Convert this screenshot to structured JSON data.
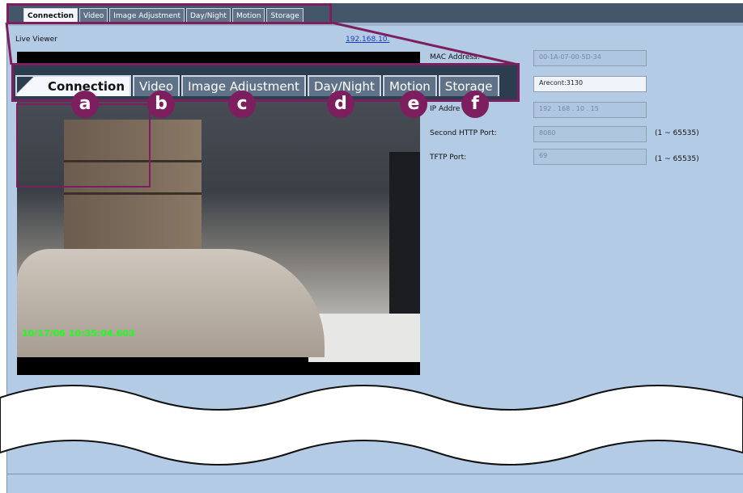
{
  "top_tabs": [
    "Connection",
    "Video",
    "Image Adjustment",
    "Day/Night",
    "Motion",
    "Storage"
  ],
  "active_tab": "Connection",
  "live_viewer_label": "Live Viewer",
  "ip_link": "192.168.10.",
  "timestamp": "10/17/06 10:35:04.603",
  "fields": [
    {
      "label": "MAC Address:",
      "value": "00-1A-07-00-5D-34"
    },
    {
      "label": "",
      "value": "Arecont:3130"
    },
    {
      "label": "IP Addre",
      "value": "192 . 168 . 10 . 15"
    },
    {
      "label": "Second HTTP Port:",
      "value": "8080",
      "range": "(1 ~ 65535)"
    },
    {
      "label": "TFTP Port:",
      "value": "69",
      "range": "(1 ~ 65535)"
    }
  ],
  "zoom_tabs": [
    "Connection",
    "Video",
    "Image Adjustment",
    "Day/Night",
    "Motion",
    "Storage"
  ],
  "badges": [
    "a",
    "b",
    "c",
    "d",
    "e",
    "f"
  ],
  "colors": {
    "accent": "#7d1f5e",
    "panel": "#b3cbe4",
    "tabbar": "#44566a"
  }
}
